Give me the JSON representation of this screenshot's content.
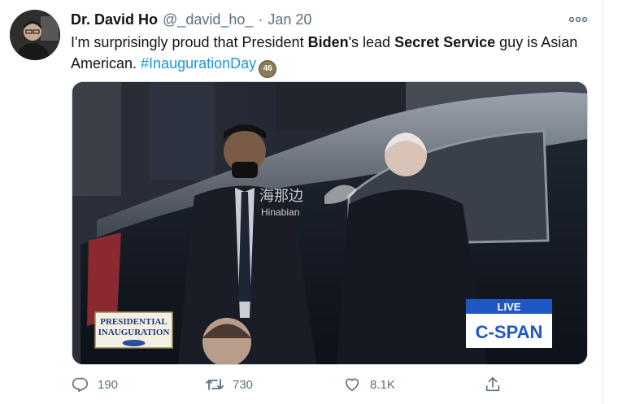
{
  "author": {
    "display_name": "Dr. David Ho",
    "handle": "@_david_ho_",
    "separator": "·",
    "date": "Jan 20"
  },
  "tweet": {
    "text_1": "I'm surprisingly proud that President ",
    "bold_1": "Biden",
    "text_2": "'s lead ",
    "bold_2": "Secret Service",
    "text_3": " guy is Asian American. ",
    "hashtag": "#InaugurationDay",
    "emoji_badge": "46"
  },
  "media": {
    "left_banner_line1": "PRESIDENTIAL",
    "left_banner_line2": "INAUGURATION",
    "live_label": "LIVE",
    "network_label": "C-SPAN",
    "watermark_cn": "海那边",
    "watermark_en": "Hinabian"
  },
  "actions": {
    "reply_count": "190",
    "retweet_count": "730",
    "like_count": "8.1K"
  },
  "icons": {
    "more": "more-horizontal-icon",
    "reply": "reply-icon",
    "retweet": "retweet-icon",
    "like": "heart-icon",
    "share": "share-icon"
  },
  "colors": {
    "hashtag": "#1b95e0",
    "muted": "#5b7083",
    "text": "#0f1419",
    "cspan_blue": "#1f58c4"
  }
}
